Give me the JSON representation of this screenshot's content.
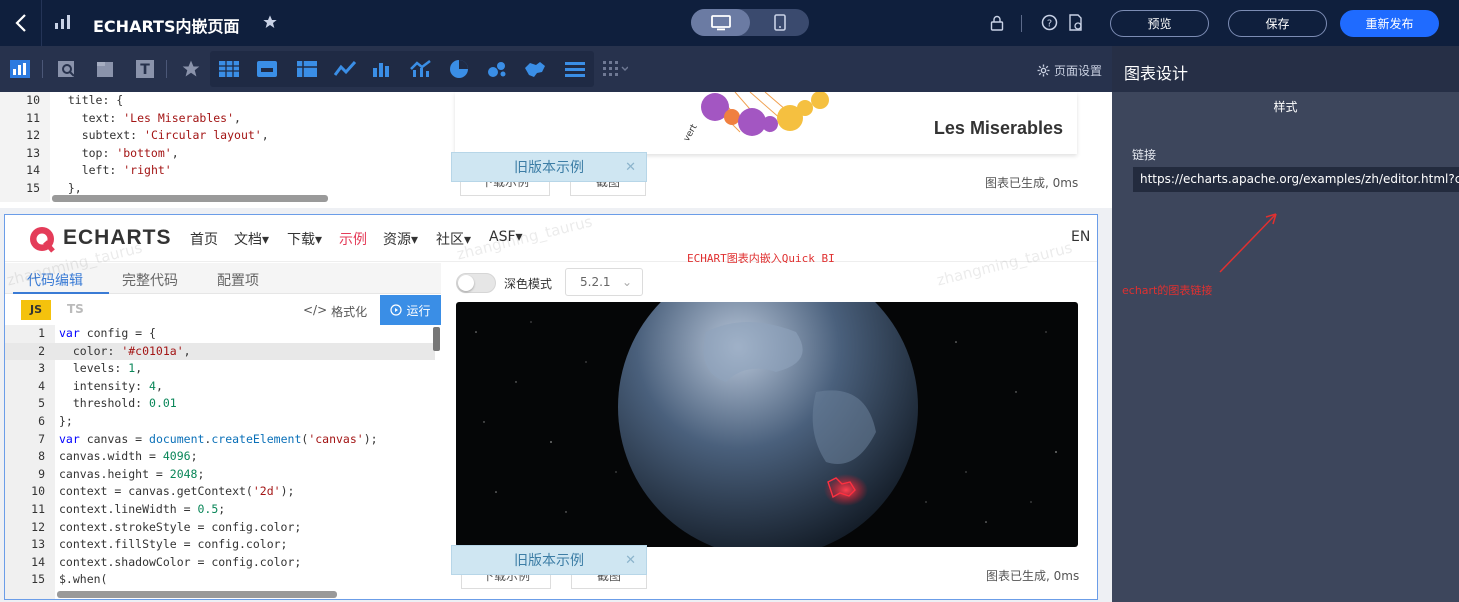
{
  "header": {
    "title": "ECHARTS内嵌页面",
    "buttons": {
      "preview": "预览",
      "save": "保存",
      "republish": "重新发布"
    }
  },
  "toolbar": {
    "page_settings": "页面设置"
  },
  "right_panel": {
    "title": "图表设计",
    "tab": "样式",
    "link_label": "链接",
    "link_value": "https://echarts.apache.org/examples/zh/editor.html?c=animat",
    "annotation": "echart的图表链接"
  },
  "upper_editor": {
    "lines": [
      {
        "n": "10",
        "parts": [
          [
            "",
            "  title: {"
          ]
        ]
      },
      {
        "n": "11",
        "parts": [
          [
            "",
            "    text: "
          ],
          [
            "str",
            "'Les Miserables'"
          ],
          [
            "",
            ","
          ]
        ]
      },
      {
        "n": "12",
        "parts": [
          [
            "",
            "    subtext: "
          ],
          [
            "str",
            "'Circular layout'"
          ],
          [
            "",
            ","
          ]
        ]
      },
      {
        "n": "13",
        "parts": [
          [
            "",
            "    top: "
          ],
          [
            "str",
            "'bottom'"
          ],
          [
            "",
            ","
          ]
        ]
      },
      {
        "n": "14",
        "parts": [
          [
            "",
            "    left: "
          ],
          [
            "str",
            "'right'"
          ]
        ]
      },
      {
        "n": "15",
        "parts": [
          [
            "",
            "  },"
          ]
        ]
      }
    ],
    "chart_title": "Les Miserables",
    "status": "图表已生成, 0ms",
    "old_version": "旧版本示例",
    "btn_download": "下载示例",
    "btn_screenshot": "截图"
  },
  "echarts_site": {
    "brand": "ECHARTS",
    "nav": [
      "首页",
      "文档▾",
      "下载▾",
      "示例",
      "资源▾",
      "社区▾",
      "ASF▾"
    ],
    "lang": "EN",
    "embed_note": "ECHART图表内嵌入Quick BI",
    "watermark": "zhangming_taurus",
    "tabs": [
      "代码编辑",
      "完整代码",
      "配置项"
    ],
    "lang_js": "JS",
    "lang_ts": "TS",
    "format": "格式化",
    "run": "运行",
    "dark_mode": "深色模式",
    "version": "5.2.1",
    "status": "图表已生成, 0ms",
    "old_version": "旧版本示例",
    "btn_download": "下载示例",
    "btn_screenshot": "截图",
    "code_lines": [
      {
        "n": "1",
        "parts": [
          [
            "kw",
            "var"
          ],
          [
            "",
            " config = {"
          ]
        ]
      },
      {
        "n": "2",
        "parts": [
          [
            "",
            "  color: "
          ],
          [
            "str",
            "'#c0101a'"
          ],
          [
            "",
            ","
          ]
        ]
      },
      {
        "n": "3",
        "parts": [
          [
            "",
            "  levels: "
          ],
          [
            "num",
            "1"
          ],
          [
            "",
            ","
          ]
        ]
      },
      {
        "n": "4",
        "parts": [
          [
            "",
            "  intensity: "
          ],
          [
            "num",
            "4"
          ],
          [
            "",
            ","
          ]
        ]
      },
      {
        "n": "5",
        "parts": [
          [
            "",
            "  threshold: "
          ],
          [
            "num",
            "0.01"
          ]
        ]
      },
      {
        "n": "6",
        "parts": [
          [
            "",
            "};"
          ]
        ]
      },
      {
        "n": "7",
        "parts": [
          [
            "kw",
            "var"
          ],
          [
            "",
            " canvas = "
          ],
          [
            "fn",
            "document"
          ],
          [
            "",
            "."
          ],
          [
            "fn",
            "createElement"
          ],
          [
            "",
            "("
          ],
          [
            "str",
            "'canvas'"
          ],
          [
            "",
            ");"
          ]
        ]
      },
      {
        "n": "8",
        "parts": [
          [
            "",
            "canvas.width = "
          ],
          [
            "num",
            "4096"
          ],
          [
            "",
            ";"
          ]
        ]
      },
      {
        "n": "9",
        "parts": [
          [
            "",
            "canvas.height = "
          ],
          [
            "num",
            "2048"
          ],
          [
            "",
            ";"
          ]
        ]
      },
      {
        "n": "10",
        "parts": [
          [
            "",
            "context = canvas.getContext("
          ],
          [
            "str",
            "'2d'"
          ],
          [
            "",
            ");"
          ]
        ]
      },
      {
        "n": "11",
        "parts": [
          [
            "",
            "context.lineWidth = "
          ],
          [
            "num",
            "0.5"
          ],
          [
            "",
            ";"
          ]
        ]
      },
      {
        "n": "12",
        "parts": [
          [
            "",
            "context.strokeStyle = config.color;"
          ]
        ]
      },
      {
        "n": "13",
        "parts": [
          [
            "",
            "context.fillStyle = config.color;"
          ]
        ]
      },
      {
        "n": "14",
        "parts": [
          [
            "",
            "context.shadowColor = config.color;"
          ]
        ]
      },
      {
        "n": "15",
        "parts": [
          [
            "",
            "$.when("
          ]
        ]
      }
    ]
  },
  "colors": {
    "accent": "#1f6bff",
    "topbar": "#0f1f3d",
    "toolbar": "#27324d",
    "panel": "#3d465c",
    "echarts_red": "#e43c59"
  }
}
